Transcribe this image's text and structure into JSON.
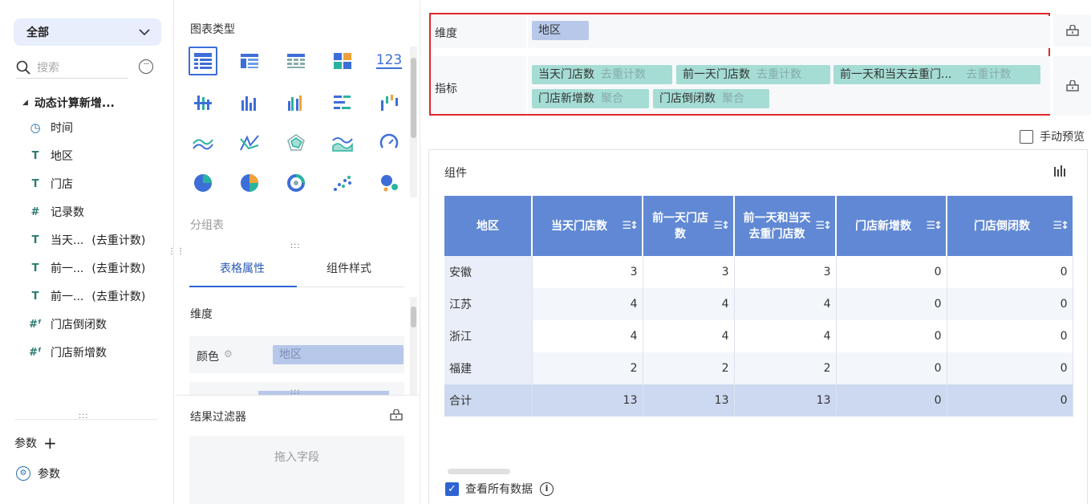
{
  "left": {
    "dropdown_label": "全部",
    "search_placeholder": "搜索",
    "tree_root": "动态计算新增...",
    "fields": [
      {
        "label": "时间",
        "icon": "clock-icon",
        "type": "date"
      },
      {
        "label": "地区",
        "icon": "text-field-icon",
        "type": "text"
      },
      {
        "label": "门店",
        "icon": "text-field-icon",
        "type": "text"
      },
      {
        "label": "记录数",
        "icon": "number-field-icon",
        "type": "number"
      },
      {
        "label": "当天...",
        "tail": "(去重计数)",
        "icon": "text-field-icon",
        "type": "text"
      },
      {
        "label": "前一...",
        "tail": "(去重计数)",
        "icon": "text-field-icon",
        "type": "text"
      },
      {
        "label": "前一...",
        "tail": "(去重计数)",
        "icon": "text-field-icon",
        "type": "text"
      },
      {
        "label": "门店倒闭数",
        "icon": "calc-number-field-icon",
        "type": "number"
      },
      {
        "label": "门店新增数",
        "icon": "calc-number-field-icon",
        "type": "number"
      }
    ],
    "params_label": "参数",
    "param_item": "参数"
  },
  "middle": {
    "chart_type_title": "图表类型",
    "chart_types": [
      "table-chart-icon",
      "grouped-table-icon",
      "cross-table-icon",
      "kpi-card-icon",
      "number-123-icon",
      "dot-bar-icon",
      "column-chart-icon",
      "grouped-column-icon",
      "bar-chart-icon",
      "waterfall-icon",
      "line-chart-icon",
      "radar-line-icon",
      "radar-chart-icon",
      "area-chart-icon",
      "gauge-icon",
      "pie-chart-icon",
      "multi-pie-icon",
      "ring-chart-icon",
      "scatter-icon",
      "bubble-icon"
    ],
    "chart_number_label": "123",
    "group_table": "分组表",
    "tab_table_props": "表格属性",
    "tab_component_style": "组件样式",
    "dimension": "维度",
    "color_label": "颜色",
    "color_field": "地区",
    "result_filter": "结果过滤器",
    "drag_hint": "拖入字段"
  },
  "right": {
    "dimension_label": "维度",
    "dimension_field": "地区",
    "metric_label": "指标",
    "metrics": [
      {
        "name": "当天门店数",
        "agg": "去重计数"
      },
      {
        "name": "前一天门店数",
        "agg": "去重计数"
      },
      {
        "name": "前一天和当天去重门...",
        "agg": "去重计数"
      },
      {
        "name": "门店新增数",
        "agg": "聚合"
      },
      {
        "name": "门店倒闭数",
        "agg": "聚合"
      }
    ],
    "manual_preview": "手动预览",
    "component_title": "组件",
    "view_all_data": "查看所有数据",
    "colors": {
      "header": "#6088d4",
      "accent": "#2f63d4",
      "highlight": "#e0262a",
      "metric_pill": "#a5ddd5",
      "dim_pill": "#b8c8ea"
    }
  },
  "table": {
    "headers": [
      "地区",
      "当天门店数",
      "前一天门店数",
      "前一天和当天去重门店数",
      "门店新增数",
      "门店倒闭数"
    ],
    "rows": [
      [
        "安徽",
        "3",
        "3",
        "3",
        "0",
        "0"
      ],
      [
        "江苏",
        "4",
        "4",
        "4",
        "0",
        "0"
      ],
      [
        "浙江",
        "4",
        "4",
        "4",
        "0",
        "0"
      ],
      [
        "福建",
        "2",
        "2",
        "2",
        "0",
        "0"
      ],
      [
        "合计",
        "13",
        "13",
        "13",
        "0",
        "0"
      ]
    ]
  }
}
